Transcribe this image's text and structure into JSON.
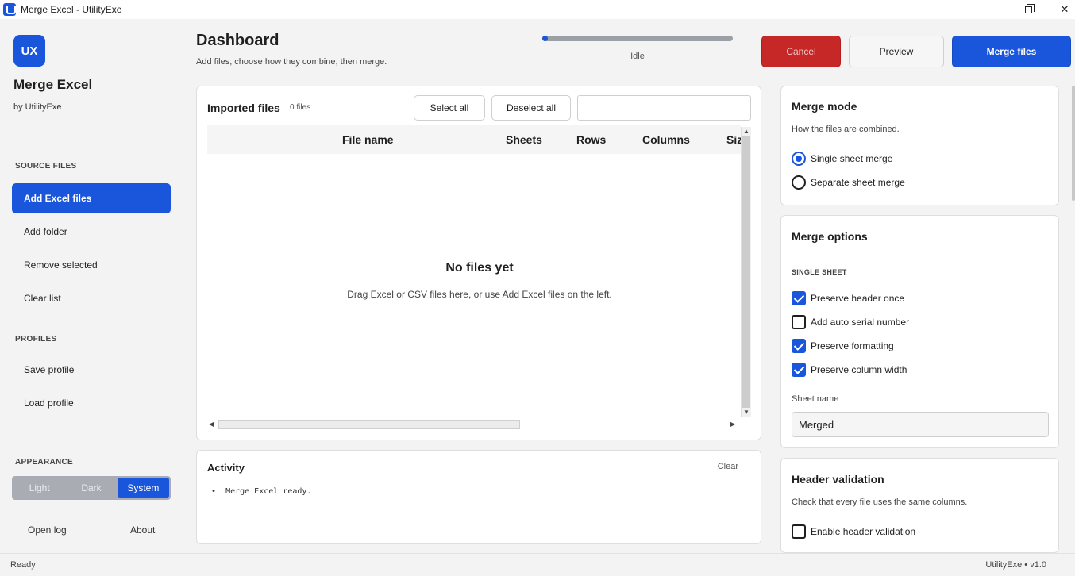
{
  "window": {
    "title": "Merge Excel - UtilityExe"
  },
  "sidebar": {
    "logo": "UX",
    "app_name": "Merge Excel",
    "by_line": "by UtilityExe",
    "source_label": "SOURCE FILES",
    "source_items": [
      {
        "label": "Add Excel files",
        "active": true
      },
      {
        "label": "Add folder"
      },
      {
        "label": "Remove selected"
      },
      {
        "label": "Clear list"
      }
    ],
    "profiles_label": "PROFILES",
    "profile_items": [
      {
        "label": "Save profile"
      },
      {
        "label": "Load profile"
      }
    ],
    "appearance_label": "APPEARANCE",
    "appearance_options": [
      "Light",
      "Dark",
      "System"
    ],
    "appearance_selected": "System",
    "open_log": "Open log",
    "about": "About"
  },
  "header": {
    "title": "Dashboard",
    "subtitle": "Add files, choose how they combine, then merge.",
    "progress_fraction": 0.0,
    "progress_status": "Idle",
    "cancel_label": "Cancel",
    "preview_label": "Preview",
    "merge_label": "Merge files"
  },
  "files": {
    "title": "Imported files",
    "count": "0 files",
    "select_all": "Select all",
    "deselect_all": "Deselect all",
    "search_value": "",
    "columns": [
      "File name",
      "Sheets",
      "Rows",
      "Columns",
      "Size"
    ],
    "rows": [],
    "empty_title": "No files yet",
    "empty_hint": "Drag Excel or CSV files here, or use Add Excel files on the left."
  },
  "activity": {
    "title": "Activity",
    "clear_label": "Clear",
    "entries": [
      "Merge Excel ready."
    ]
  },
  "merge_mode": {
    "title": "Merge mode",
    "subtitle": "How the files are combined.",
    "options": [
      {
        "label": "Single sheet merge",
        "selected": true
      },
      {
        "label": "Separate sheet merge",
        "selected": false
      }
    ]
  },
  "merge_options": {
    "title": "Merge options",
    "section": "SINGLE SHEET",
    "checks": [
      {
        "label": "Preserve header once",
        "checked": true
      },
      {
        "label": "Add auto serial number",
        "checked": false
      },
      {
        "label": "Preserve formatting",
        "checked": true
      },
      {
        "label": "Preserve column width",
        "checked": true
      }
    ],
    "sheet_name_label": "Sheet name",
    "sheet_name_value": "Merged"
  },
  "header_validation": {
    "title": "Header validation",
    "subtitle": "Check that every file uses the same columns.",
    "enable_label": "Enable header validation",
    "enabled": false
  },
  "status": {
    "left": "Ready",
    "right": "UtilityExe  •  v1.0"
  },
  "colors": {
    "accent": "#1a56db",
    "danger": "#c62828",
    "surface": "#ffffff",
    "background": "#f3f3f3"
  }
}
